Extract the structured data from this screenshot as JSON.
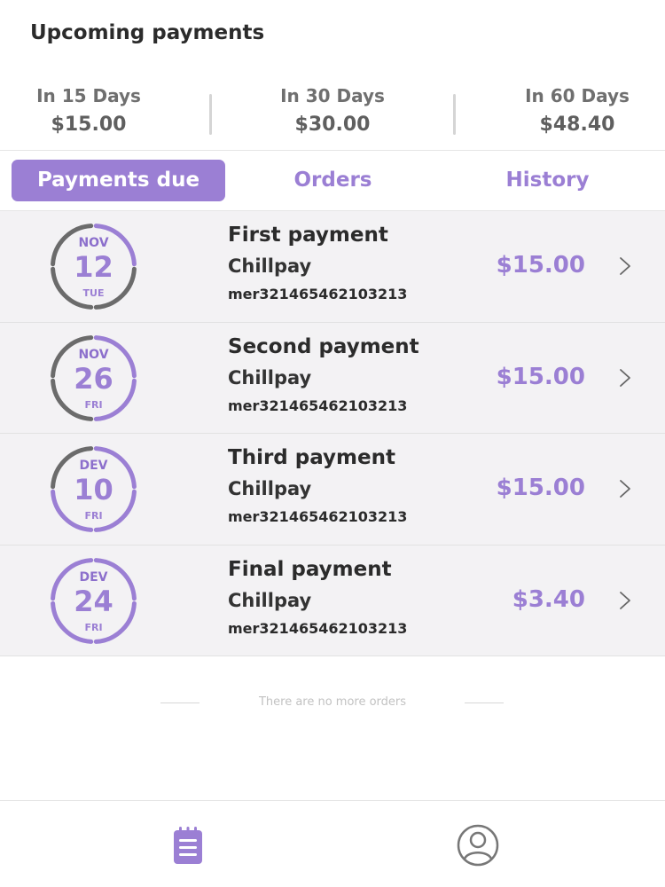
{
  "header": {
    "title": "Upcoming payments"
  },
  "summary": [
    {
      "label": "In 15 Days",
      "amount": "$15.00"
    },
    {
      "label": "In 30 Days",
      "amount": "$30.00"
    },
    {
      "label": "In 60 Days",
      "amount": "$48.40"
    }
  ],
  "tabs": [
    {
      "label": "Payments due",
      "active": true
    },
    {
      "label": "Orders",
      "active": false
    },
    {
      "label": "History",
      "active": false
    }
  ],
  "payments": [
    {
      "month": "NOV",
      "day": "12",
      "weekday": "TUE",
      "title": "First payment",
      "merchant": "Chillpay",
      "ref": "mer321465462103213",
      "amount": "$15.00",
      "progress": 0.25
    },
    {
      "month": "NOV",
      "day": "26",
      "weekday": "FRI",
      "title": "Second payment",
      "merchant": "Chillpay",
      "ref": "mer321465462103213",
      "amount": "$15.00",
      "progress": 0.5
    },
    {
      "month": "DEV",
      "day": "10",
      "weekday": "FRI",
      "title": "Third payment",
      "merchant": "Chillpay",
      "ref": "mer321465462103213",
      "amount": "$15.00",
      "progress": 0.75
    },
    {
      "month": "DEV",
      "day": "24",
      "weekday": "FRI",
      "title": "Final payment",
      "merchant": "Chillpay",
      "ref": "mer321465462103213",
      "amount": "$3.40",
      "progress": 1.0
    }
  ],
  "list_end_text": "There are no more orders",
  "colors": {
    "accent": "#9b7fd4",
    "ring_inactive": "#6b6b6b",
    "row_bg": "#f3f2f4"
  },
  "bottom_nav": [
    {
      "icon": "clipboard-list-icon",
      "active": true
    },
    {
      "icon": "user-circle-icon",
      "active": false
    }
  ]
}
